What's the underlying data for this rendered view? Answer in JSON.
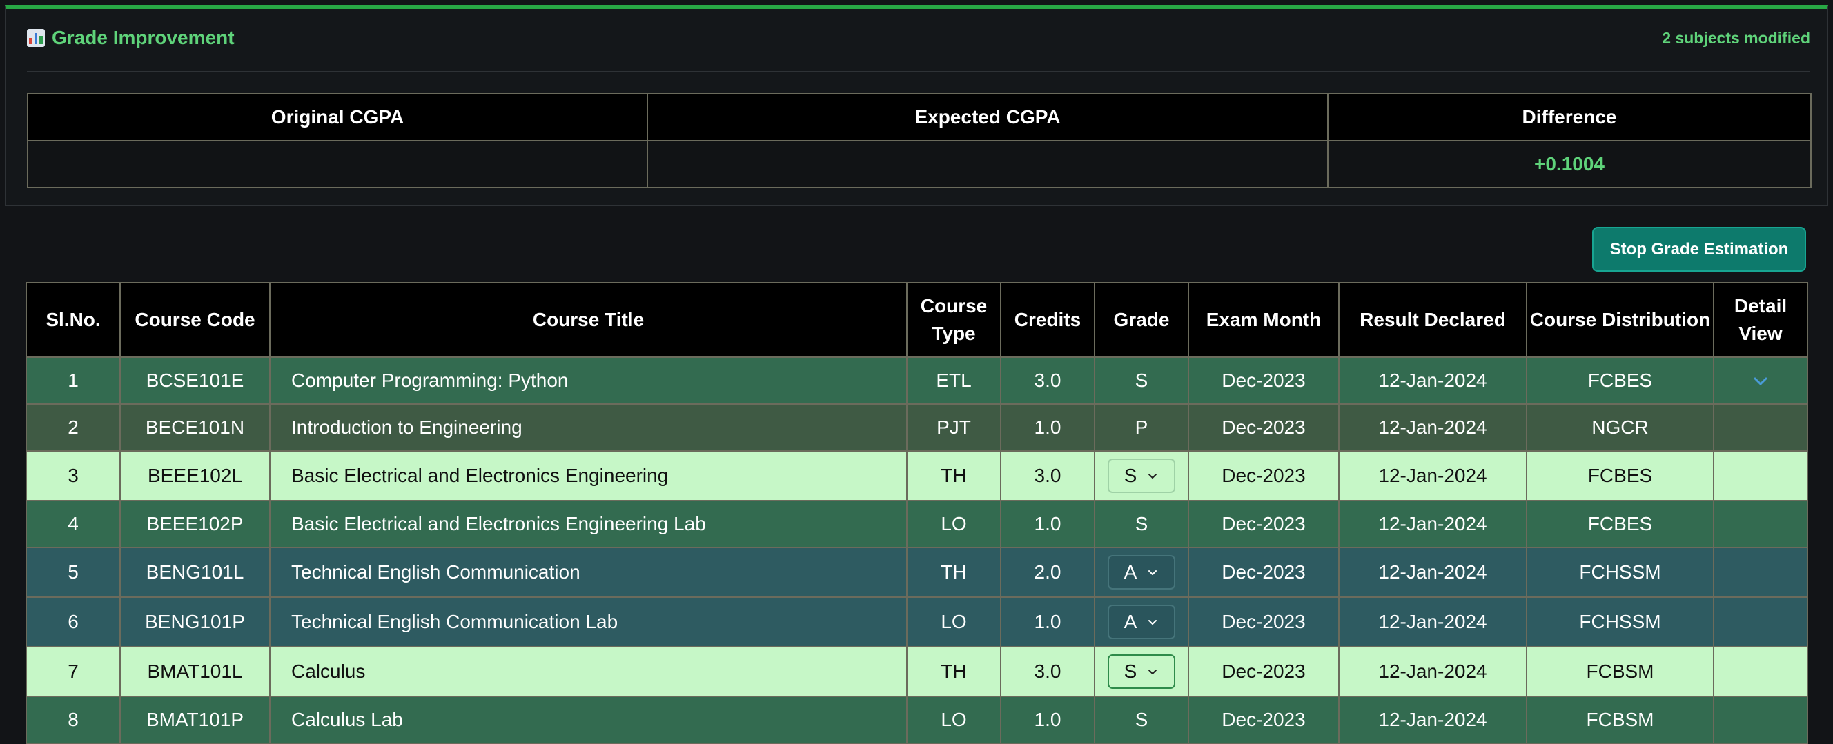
{
  "panel": {
    "title": "Grade Improvement",
    "modified_text": "2 subjects modified",
    "accent": "#28a745",
    "icon": "bar-chart-icon"
  },
  "cgpa": {
    "headers": [
      "Original CGPA",
      "Expected CGPA",
      "Difference"
    ],
    "original": "",
    "expected": "",
    "difference": "+0.1004"
  },
  "stop_button": "Stop Grade Estimation",
  "table": {
    "headers": {
      "slno": "Sl.No.",
      "code": "Course Code",
      "title": "Course Title",
      "type": "Course Type",
      "credits": "Credits",
      "grade": "Grade",
      "exam": "Exam Month",
      "result": "Result Declared",
      "dist": "Course Distribution",
      "detail": "Detail View"
    },
    "rows": [
      {
        "no": "1",
        "code": "BCSE101E",
        "title": "Computer Programming: Python",
        "type": "ETL",
        "credits": "3.0",
        "grade": "S",
        "exam": "Dec-2023",
        "result": "12-Jan-2024",
        "dist": "FCBES",
        "editable": false,
        "detail_icon": "chevron-down-icon"
      },
      {
        "no": "2",
        "code": "BECE101N",
        "title": "Introduction to Engineering",
        "type": "PJT",
        "credits": "1.0",
        "grade": "P",
        "exam": "Dec-2023",
        "result": "12-Jan-2024",
        "dist": "NGCR",
        "editable": false
      },
      {
        "no": "3",
        "code": "BEEE102L",
        "title": "Basic Electrical and Electronics Engineering",
        "type": "TH",
        "credits": "3.0",
        "grade": "S",
        "exam": "Dec-2023",
        "result": "12-Jan-2024",
        "dist": "FCBES",
        "editable": true
      },
      {
        "no": "4",
        "code": "BEEE102P",
        "title": "Basic Electrical and Electronics Engineering Lab",
        "type": "LO",
        "credits": "1.0",
        "grade": "S",
        "exam": "Dec-2023",
        "result": "12-Jan-2024",
        "dist": "FCBES",
        "editable": false
      },
      {
        "no": "5",
        "code": "BENG101L",
        "title": "Technical English Communication",
        "type": "TH",
        "credits": "2.0",
        "grade": "A",
        "exam": "Dec-2023",
        "result": "12-Jan-2024",
        "dist": "FCHSSM",
        "editable": true
      },
      {
        "no": "6",
        "code": "BENG101P",
        "title": "Technical English Communication Lab",
        "type": "LO",
        "credits": "1.0",
        "grade": "A",
        "exam": "Dec-2023",
        "result": "12-Jan-2024",
        "dist": "FCHSSM",
        "editable": true
      },
      {
        "no": "7",
        "code": "BMAT101L",
        "title": "Calculus",
        "type": "TH",
        "credits": "3.0",
        "grade": "S",
        "exam": "Dec-2023",
        "result": "12-Jan-2024",
        "dist": "FCBSM",
        "editable": true
      },
      {
        "no": "8",
        "code": "BMAT101P",
        "title": "Calculus Lab",
        "type": "LO",
        "credits": "1.0",
        "grade": "S",
        "exam": "Dec-2023",
        "result": "12-Jan-2024",
        "dist": "FCBSM",
        "editable": false
      }
    ]
  },
  "colors": {
    "accent_green": "#5fd37a",
    "row_green": "#336b50",
    "row_olive": "#3f5a44",
    "row_modified": "#c6f7c7",
    "row_teal": "#2e5b61",
    "button": "#0d7a6c"
  }
}
